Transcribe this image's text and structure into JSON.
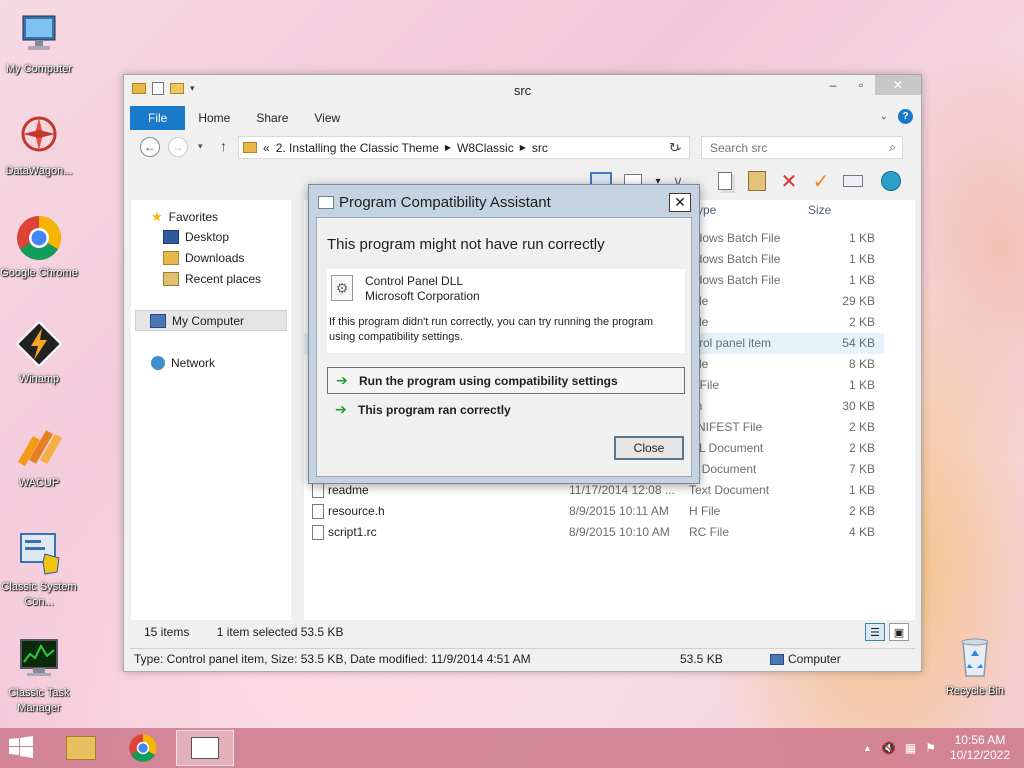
{
  "desktop": {
    "icons": [
      {
        "label": "My Computer"
      },
      {
        "label": "DataWagon..."
      },
      {
        "label": "Google Chrome"
      },
      {
        "label": "Winamp"
      },
      {
        "label": "WACUP"
      },
      {
        "label": "Classic System Con..."
      },
      {
        "label": "Classic Task Manager"
      },
      {
        "label": "Recycle Bin"
      }
    ]
  },
  "explorer": {
    "title": "src",
    "tabs": {
      "file": "File",
      "home": "Home",
      "share": "Share",
      "view": "View"
    },
    "address": {
      "prefix": "«",
      "segments": [
        "2. Installing the Classic Theme",
        "W8Classic",
        "src"
      ]
    },
    "search_placeholder": "Search src",
    "nav": {
      "favorites": "Favorites",
      "desktop": "Desktop",
      "downloads": "Downloads",
      "recent": "Recent places",
      "my_computer": "My Computer",
      "network": "Network"
    },
    "columns": {
      "type": "ype",
      "size": "Size"
    },
    "rows": [
      {
        "type": "ndows Batch File",
        "size": "1 KB"
      },
      {
        "type": "ndows Batch File",
        "size": "1 KB"
      },
      {
        "type": "ndows Batch File",
        "size": "1 KB"
      },
      {
        "type": "File",
        "size": "29 KB"
      },
      {
        "type": "File",
        "size": "2 KB"
      },
      {
        "type": "ntrol panel item",
        "size": "54 KB"
      },
      {
        "type": "File",
        "size": "8 KB"
      },
      {
        "type": "F File",
        "size": "1 KB"
      },
      {
        "type": "on",
        "size": "30 KB"
      },
      {
        "type": "ANIFEST File",
        "size": "2 KB"
      },
      {
        "type": "ML Document",
        "size": "2 KB"
      },
      {
        "type": "xt Document",
        "size": "7 KB"
      },
      {
        "name": "readme",
        "date": "11/17/2014 12:08 ...",
        "type": "Text Document",
        "size": "1 KB"
      },
      {
        "name": "resource.h",
        "date": "8/9/2015 10:11 AM",
        "type": "H File",
        "size": "2 KB"
      },
      {
        "name": "script1.rc",
        "date": "8/9/2015 10:10 AM",
        "type": "RC File",
        "size": "4 KB"
      }
    ],
    "status": {
      "items": "15 items",
      "selected": "1 item selected  53.5 KB",
      "details": "Type: Control panel item, Size: 53.5 KB, Date modified: 11/9/2014 4:51 AM",
      "size": "53.5 KB",
      "location": "Computer"
    }
  },
  "dialog": {
    "title": "Program Compatibility Assistant",
    "heading": "This program might not have run correctly",
    "program_name": "Control Panel DLL",
    "publisher": "Microsoft Corporation",
    "info": "If this program didn't run correctly, you can try running the program using compatibility settings.",
    "option1": "Run the program using compatibility settings",
    "option2": "This program ran correctly",
    "close_label": "Close"
  },
  "taskbar": {
    "time": "10:56 AM",
    "date": "10/12/2022"
  },
  "colors": {
    "accent": "#1979ca",
    "selection": "#e5f3fb",
    "dialog_frame": "#c4d2e1"
  }
}
